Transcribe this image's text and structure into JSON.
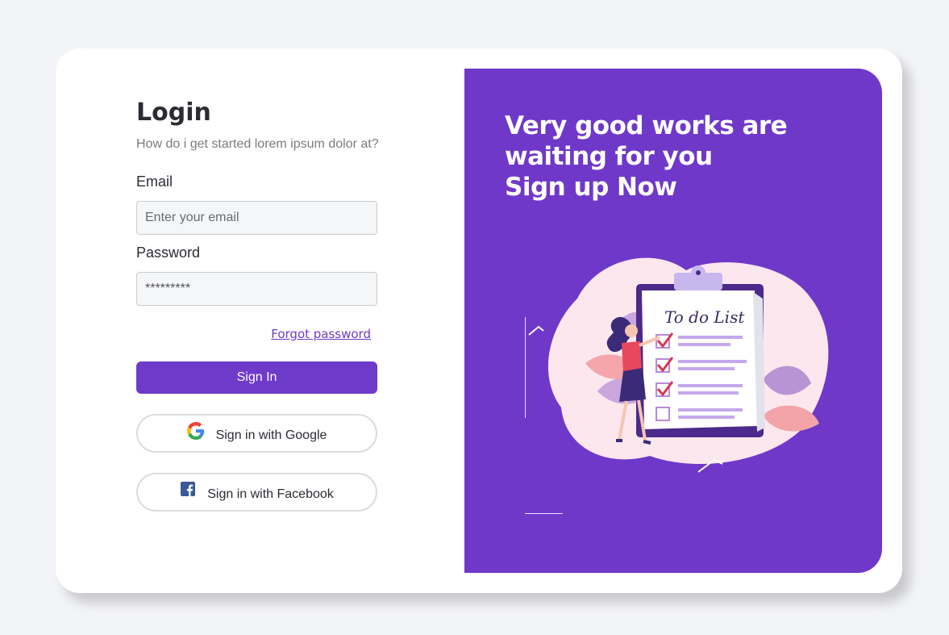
{
  "login": {
    "title": "Login",
    "subtitle": "How do i get started lorem ipsum dolor at?",
    "email_label": "Email",
    "email_placeholder": "Enter your email",
    "password_label": "Password",
    "password_value": "*********",
    "forgot_label": "Forgot password",
    "signin_label": "Sign In",
    "google_label": "Sign in with Google",
    "facebook_label": "Sign in with Facebook"
  },
  "promo": {
    "line1": "Very good works are",
    "line2": "waiting for you",
    "line3": "Sign up Now",
    "illustration_text": "To do List"
  },
  "colors": {
    "accent": "#6e3ac9",
    "page_bg": "#f3f4f8",
    "card_bg": "#ffffff"
  },
  "icons": [
    "google-icon",
    "facebook-icon"
  ]
}
